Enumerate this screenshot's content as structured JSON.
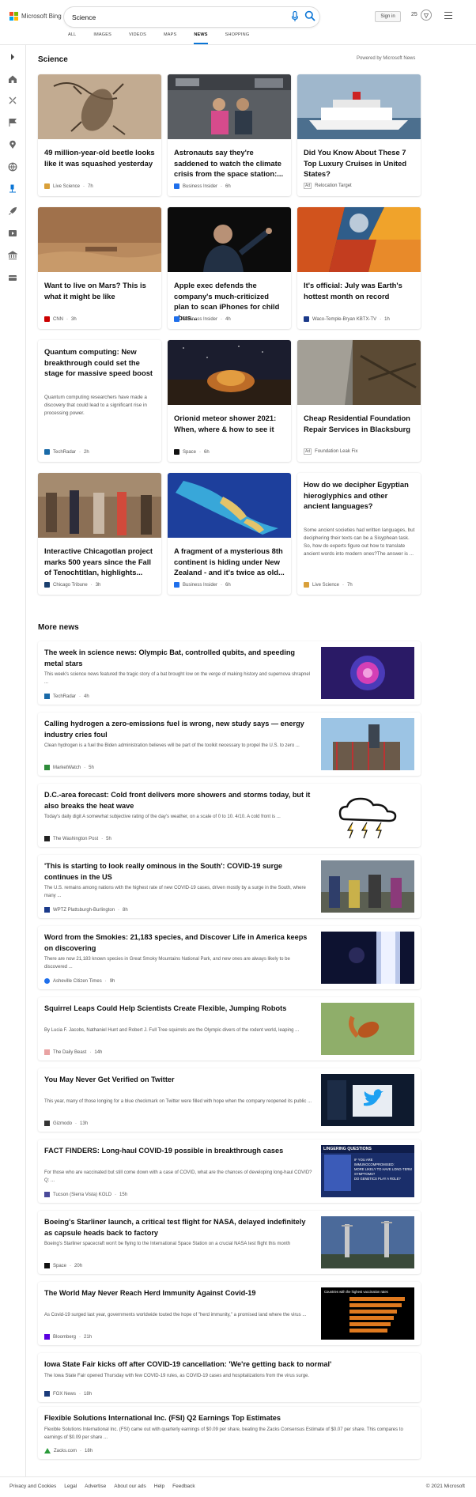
{
  "header": {
    "brand": "Microsoft Bing",
    "search_value": "Science",
    "signin_label": "Sign in",
    "points": "25",
    "tabs": [
      "ALL",
      "IMAGES",
      "VIDEOS",
      "MAPS",
      "NEWS",
      "SHOPPING"
    ],
    "active_tab": "NEWS"
  },
  "science": {
    "title": "Science",
    "powered_by": "Powered by Microsoft News",
    "cards": [
      {
        "title": "49 million-year-old beetle looks like it was squashed yesterday",
        "source": "Live Science",
        "time": "7h",
        "favicon_color": "#d9a03a"
      },
      {
        "title": "Astronauts say they're saddened to watch the climate crisis from the space station:...",
        "source": "Business Insider",
        "time": "6h",
        "favicon_color": "#1f6feb"
      },
      {
        "title": "Did You Know About These 7 Top Luxury Cruises in United States?",
        "source": "Relocation Target",
        "ad_label": "Ad",
        "favicon_color": "#ffffff"
      },
      {
        "title": "Want to live on Mars? This is what it might be like",
        "source": "CNN",
        "time": "3h",
        "favicon_color": "#cc0000"
      },
      {
        "title": "Apple exec defends the company's much-criticized plan to scan iPhones for child abus...",
        "source": "Business Insider",
        "time": "4h",
        "favicon_color": "#1f6feb"
      },
      {
        "title": "It's official: July was Earth's hottest month on record",
        "source": "Waco-Temple-Bryan KBTX-TV",
        "time": "1h",
        "favicon_color": "#1b3a8a"
      },
      {
        "title": "Quantum computing: New breakthrough could set the stage for massive speed boost",
        "desc": "Quantum computing researchers have made a discovery that could lead to a significant rise in processing power.",
        "source": "TechRadar",
        "time": "2h",
        "favicon_color": "#1a6aa8"
      },
      {
        "title": "Orionid meteor shower 2021: When, where & how to see it",
        "source": "Space",
        "time": "6h",
        "favicon_color": "#111111"
      },
      {
        "title": "Cheap Residential Foundation Repair Services in Blacksburg",
        "source": "Foundation Leak Fix",
        "ad_label": "Ad",
        "favicon_color": "#ffffff"
      },
      {
        "title": "Interactive Chicagotlan project marks 500 years since the Fall of Tenochtitlan, highlights...",
        "source": "Chicago Tribune",
        "time": "3h",
        "favicon_color": "#1a3f6e"
      },
      {
        "title": "A fragment of a mysterious 8th continent is hiding under New Zealand - and it's twice as old...",
        "source": "Business Insider",
        "time": "6h",
        "favicon_color": "#1f6feb"
      },
      {
        "title": "How do we decipher Egyptian hieroglyphics and other ancient languages?",
        "desc": "Some ancient societies had written languages, but deciphering their texts can be a Sisyphean task. So, how do experts figure out how to translate ancient words into modern ones?The answer is ...",
        "source": "Live Science",
        "time": "7h",
        "favicon_color": "#d9a03a"
      }
    ]
  },
  "more_news": {
    "title": "More news",
    "items": [
      {
        "title": "The week in science news: Olympic Bat, controlled qubits, and speeding metal stars",
        "desc": "This week's science news featured the tragic story of a bat brought low on the verge of making history and supernova shrapnel ...",
        "source": "TechRadar",
        "time": "4h",
        "favicon_color": "#1a6aa8"
      },
      {
        "title": "Calling hydrogen a zero-emissions fuel is wrong, new study says — energy industry cries foul",
        "desc": "Clean hydrogen is a fuel the Biden administration believes will be part of the toolkit necessary to propel the U.S. to zero ...",
        "source": "MarketWatch",
        "time": "5h",
        "favicon_color": "#2e8b3a"
      },
      {
        "title": "D.C.-area forecast: Cold front delivers more showers and storms today, but it also breaks the heat wave",
        "desc": "Today's daily digit A somewhat subjective rating of the day's weather, on a scale of 0 to 10. 4/10. A cold front is ...",
        "source": "The Washington Post",
        "time": "5h",
        "favicon_color": "#222222"
      },
      {
        "title": "'This is starting to look really ominous in the South': COVID-19 surge continues in the US",
        "desc": "The U.S. remains among nations with the highest rate of new COVID-19 cases, driven mostly by a surge in the South, where many ...",
        "source": "WPTZ Plattsburgh-Burlington",
        "time": "8h",
        "favicon_color": "#1b3a8a"
      },
      {
        "title": "Word from the Smokies: 21,183 species, and Discover Life in America keeps on discovering",
        "desc": "There are now 21,183 known species in Great Smoky Mountains National Park, and new ones are always likely to be discovered ...",
        "source": "Asheville Citizen Times",
        "time": "9h",
        "favicon_color": "#1f6feb"
      },
      {
        "title": "Squirrel Leaps Could Help Scientists Create Flexible, Jumping Robots",
        "desc": "By Lucia F. Jacobs, Nathaniel Hunt and Robert J. Full Tree squirrels are the Olympic divers of the rodent world, leaping ...",
        "source": "The Daily Beast",
        "time": "14h",
        "favicon_color": "#e9a3a3"
      },
      {
        "title": "You May Never Get Verified on Twitter",
        "desc": "This year, many of those longing for a blue checkmark on Twitter were filled with hope when the company reopened its public ...",
        "source": "Gizmodo",
        "time": "13h",
        "favicon_color": "#333333"
      },
      {
        "title": "FACT FINDERS: Long-haul COVID-19 possible in breakthrough cases",
        "desc": "For those who are vaccinated but still come down with a case of COVID, what are the chances of developing long-haul COVID? Q: ...",
        "source": "Tucson (Sierra Vista) KOLD",
        "time": "15h",
        "favicon_color": "#4a4a9a"
      },
      {
        "title": "Boeing's Starliner launch, a critical test flight for NASA, delayed indefinitely as capsule heads back to factory",
        "desc": "Boeing's Starliner spacecraft won't be flying to the International Space Station on a crucial NASA test flight this month",
        "source": "Space",
        "time": "20h",
        "favicon_color": "#111111"
      },
      {
        "title": "The World May Never Reach Herd Immunity Against Covid-19",
        "desc": "As Covid-19 surged last year, governments worldwide touted the hope of \"herd immunity,\" a promised land where the virus ...",
        "source": "Bloomberg",
        "time": "21h",
        "favicon_color": "#5a00e0"
      },
      {
        "title": "Iowa State Fair kicks off after COVID-19 cancellation: 'We're getting back to normal'",
        "desc": "The Iowa State Fair opened Thursday with few COVID-19 rules, as COVID-19 cases and hospitalizations from the virus surge.",
        "source": "FOX News",
        "time": "18h",
        "favicon_color": "#1a3a7a"
      },
      {
        "title": "Flexible Solutions International Inc. (FSI) Q2 Earnings Top Estimates",
        "desc": "Flexible Solutions International Inc. (FSI) came out with quarterly earnings of $0.09 per share, beating the Zacks Consensus Estimate of $0.07 per share. This compares to earnings of $0.09 per share ...",
        "source": "Zacks.com",
        "time": "18h",
        "favicon_color": "#2a9a3a"
      }
    ],
    "image_texts": {
      "covid_banner": "LINGERING QUESTIONS",
      "covid_lines": [
        "IF YOU ARE IMMUNOCOMPROMISED:",
        "MORE LIKELY TO HAVE LONG-TERM SYMPTOMS?",
        "DO GENETICS PLAY A ROLE?"
      ],
      "bloomberg_caption": "Countries with the highest vaccination rates"
    }
  },
  "footer": {
    "links": [
      "Privacy and Cookies",
      "Legal",
      "Advertise",
      "About our ads",
      "Help",
      "Feedback"
    ],
    "copyright": "© 2021 Microsoft"
  },
  "colors": {
    "accent": "#0a75d6",
    "logo": [
      "#f25022",
      "#7fba00",
      "#00a4ef",
      "#ffb900"
    ]
  }
}
